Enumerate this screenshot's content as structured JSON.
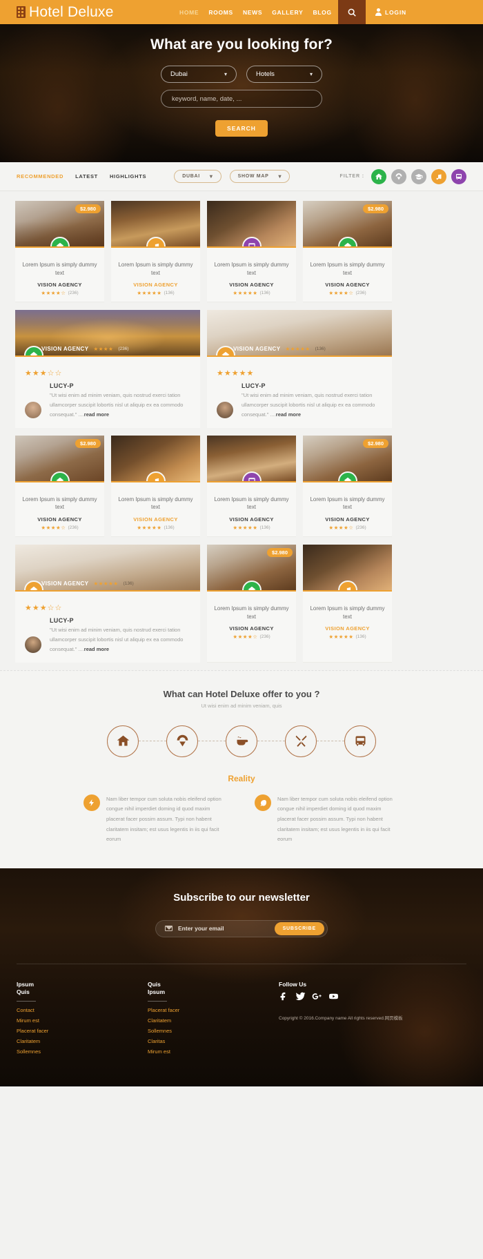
{
  "header": {
    "brand": "Hotel Deluxe",
    "nav": [
      {
        "label": "HOME",
        "active": true
      },
      {
        "label": "ROOMS",
        "active": false
      },
      {
        "label": "NEWS",
        "active": false
      },
      {
        "label": "GALLERY",
        "active": false
      },
      {
        "label": "BLOG",
        "active": false
      }
    ],
    "search_icon": "search-icon",
    "login_label": "LOGIN"
  },
  "hero": {
    "title": "What are you looking for?",
    "city_select": "Dubai",
    "type_select": "Hotels",
    "keyword_placeholder": "keyword, name, date, ...",
    "search_button": "SEARCH"
  },
  "filterbar": {
    "tabs": [
      {
        "label": "RECOMMENDED",
        "active": true
      },
      {
        "label": "LATEST",
        "active": false
      },
      {
        "label": "HIGHLIGHTS",
        "active": false
      }
    ],
    "pills": [
      {
        "label": "DUBAI"
      },
      {
        "label": "SHOW MAP"
      }
    ],
    "filter_label": "FILTER :",
    "icons": [
      {
        "name": "home-icon",
        "color": "#2cb34a"
      },
      {
        "name": "parachute-icon",
        "color": "#b0b0b0"
      },
      {
        "name": "graduation-icon",
        "color": "#b0b0b0"
      },
      {
        "name": "music-icon",
        "color": "#eea131"
      },
      {
        "name": "bus-icon",
        "color": "#8e44ad"
      }
    ]
  },
  "listings": {
    "title": "Lorem Ipsum is simply dummy text",
    "agency": "VISION AGENCY",
    "price": "$2.980",
    "rows": [
      {
        "type": "cards",
        "cards": [
          {
            "price": "$2.980",
            "badge": "home-icon",
            "badge_color": "#2cb34a",
            "agency_gold": false,
            "stars": 4,
            "count": "(236)",
            "img": "dining-room"
          },
          {
            "price": "",
            "badge": "music-icon",
            "badge_color": "#eea131",
            "agency_gold": true,
            "stars": 5,
            "count": "(136)",
            "img": "restaurant-warm"
          },
          {
            "price": "",
            "badge": "bus-icon",
            "badge_color": "#8e44ad",
            "agency_gold": false,
            "stars": 5,
            "count": "(136)",
            "img": "atrium"
          },
          {
            "price": "$2.980",
            "badge": "home-icon",
            "badge_color": "#2cb34a",
            "agency_gold": false,
            "stars": 4,
            "count": "(236)",
            "img": "lounge"
          }
        ]
      },
      {
        "type": "reviews",
        "reviews": [
          {
            "agency": "VISION AGENCY",
            "header_stars": 4,
            "header_count": "(236)",
            "badge": "home-icon",
            "badge_color": "#2cb34a",
            "stars": 3,
            "author": "LUCY-P",
            "text": "\"Ut wisi enim ad minim veniam, quis nostrud exerci tation ullamcorper suscipit lobortis nisl ut aliquip ex ea commodo consequat.\" ....",
            "read_more": "read more",
            "img": "atlantis"
          },
          {
            "agency": "VISION AGENCY",
            "header_stars": 5,
            "header_count": "(136)",
            "badge": "home-icon",
            "badge_color": "#eea131",
            "stars": 5,
            "author": "LUCY-P",
            "text": "\"Ut wisi enim ad minim veniam, quis nostrud exerci tation ullamcorper suscipit lobortis nisl ut aliquip ex ea commodo consequat.\" ....",
            "read_more": "read more",
            "img": "spa-beds"
          }
        ]
      },
      {
        "type": "cards",
        "cards": [
          {
            "price": "$2.980",
            "badge": "home-icon",
            "badge_color": "#2cb34a",
            "agency_gold": false,
            "stars": 4,
            "count": "(236)",
            "img": "dining-room"
          },
          {
            "price": "",
            "badge": "music-icon",
            "badge_color": "#eea131",
            "agency_gold": true,
            "stars": 5,
            "count": "(136)",
            "img": "atrium"
          },
          {
            "price": "",
            "badge": "bus-icon",
            "badge_color": "#8e44ad",
            "agency_gold": false,
            "stars": 5,
            "count": "(136)",
            "img": "restaurant-warm"
          },
          {
            "price": "$2.980",
            "badge": "home-icon",
            "badge_color": "#2cb34a",
            "agency_gold": false,
            "stars": 4,
            "count": "(236)",
            "img": "lounge"
          }
        ]
      },
      {
        "type": "mixed",
        "review": {
          "agency": "VISION AGENCY",
          "header_stars": 5,
          "header_count": "(136)",
          "badge": "home-icon",
          "badge_color": "#eea131",
          "stars": 3,
          "author": "LUCY-P",
          "text": "\"Ut wisi enim ad minim veniam, quis nostrud exerci tation ullamcorper suscipit lobortis nisl ut aliquip ex ea commodo consequat.\" ....",
          "read_more": "read more",
          "img": "spa-beds"
        },
        "cards": [
          {
            "price": "$2.980",
            "badge": "home-icon",
            "badge_color": "#2cb34a",
            "agency_gold": false,
            "stars": 4,
            "count": "(236)",
            "img": "lounge"
          },
          {
            "price": "",
            "badge": "music-icon",
            "badge_color": "#eea131",
            "agency_gold": true,
            "stars": 5,
            "count": "(136)",
            "img": "atrium"
          }
        ]
      }
    ]
  },
  "offer": {
    "title": "What can Hotel Deluxe offer to you ?",
    "subtitle": "Ut wisi enim ad minim veniam, quis",
    "steps": [
      {
        "name": "home-icon"
      },
      {
        "name": "parachute-icon"
      },
      {
        "name": "coffee-icon"
      },
      {
        "name": "cutlery-icon"
      },
      {
        "name": "bus-icon"
      }
    ],
    "reality": "Reality",
    "columns": [
      {
        "icon": "bolt-icon",
        "text": "Nam liber tempor cum soluta nobis eleifend option congue nihil imperdiet doming id quod maxim placerat facer possim assum. Typi non habent claritatem insitam; est usus legentis in iis qui facit eorum"
      },
      {
        "icon": "leaf-icon",
        "text": "Nam liber tempor cum soluta nobis eleifend option congue nihil imperdiet doming id quod maxim placerat facer possim assum. Typi non habent claritatem insitam; est usus legentis in iis qui facit eorum"
      }
    ]
  },
  "footer": {
    "newsletter_title": "Subscribe to our newsletter",
    "email_placeholder": "Enter your email",
    "subscribe_button": "SUBSCRIBE",
    "columns": [
      {
        "heading": "Ipsum\nQuis",
        "links": [
          "Contact",
          "Mirum est",
          "Placerat facer",
          "Claritatem",
          "Sollemnes"
        ]
      },
      {
        "heading": "Quis\nIpsum",
        "links": [
          "Placerat facer",
          "Claritatem",
          "Sollemnes",
          "Claritas",
          "Mirum est"
        ]
      }
    ],
    "follow_heading": "Follow Us",
    "social": [
      "facebook-icon",
      "twitter-icon",
      "google-plus-icon",
      "youtube-icon"
    ],
    "copyright": "Copyright © 2016.Company name All rights reserved.网页模板"
  }
}
